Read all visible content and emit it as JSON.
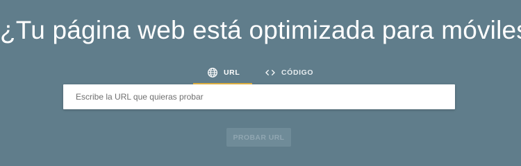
{
  "header": {
    "title": "¿Tu página web está optimizada para móviles?"
  },
  "tabs": [
    {
      "label": "URL",
      "icon": "globe-icon",
      "selected": true
    },
    {
      "label": "CÓDIGO",
      "icon": "code-icon",
      "selected": false
    }
  ],
  "search": {
    "placeholder": "Escribe la URL que quieras probar",
    "value": ""
  },
  "actions": {
    "submit_label": "PROBAR URL"
  },
  "colors": {
    "background": "#607d8b",
    "tab_indicator": "#e3b341",
    "button_disabled_bg": "#6f8b98",
    "button_disabled_text": "#90a6b1"
  }
}
